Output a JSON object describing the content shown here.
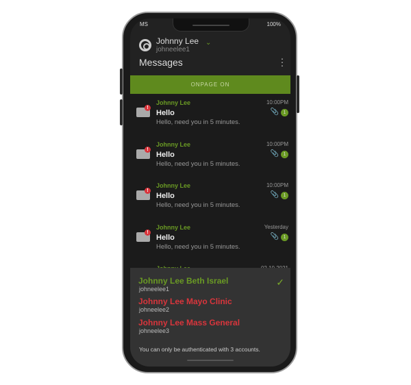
{
  "status": {
    "carrier": "MS",
    "battery": "100%"
  },
  "account": {
    "name": "Johnny Lee",
    "username": "johneelee1"
  },
  "header": {
    "title": "Messages"
  },
  "banner": {
    "label": "ONPAGE ON"
  },
  "messages": [
    {
      "from": "Johnny Lee",
      "subject": "Hello",
      "preview": "Hello, need you in 5 minutes.",
      "time": "10:00PM",
      "count": "1",
      "icon": "envelope-closed-icon"
    },
    {
      "from": "Johnny Lee",
      "subject": "Hello",
      "preview": "Hello, need you in 5 minutes.",
      "time": "10:00PM",
      "count": "1",
      "icon": "envelope-closed-icon"
    },
    {
      "from": "Johnny Lee",
      "subject": "Hello",
      "preview": "Hello, need you in 5 minutes.",
      "time": "10:00PM",
      "count": "1",
      "icon": "envelope-closed-icon"
    },
    {
      "from": "Johnny Lee",
      "subject": "Hello",
      "preview": "Hello, need you in 5 minutes.",
      "time": "Yesterday",
      "count": "1",
      "icon": "envelope-open-icon"
    },
    {
      "from": "Johnny Lee",
      "time": "02.10.2021"
    }
  ],
  "accounts": [
    {
      "name": "Johnny Lee Beth Israel",
      "username": "johneelee1",
      "color": "#6a9a24",
      "selected": true
    },
    {
      "name": "Johnny Lee Mayo Clinic",
      "username": "johneelee2",
      "color": "#d9353c"
    },
    {
      "name": "Johnny Lee Mass General",
      "username": "johneelee3",
      "color": "#d9353c"
    }
  ],
  "accounts_note": "You can only be authenticated with 3 accounts."
}
